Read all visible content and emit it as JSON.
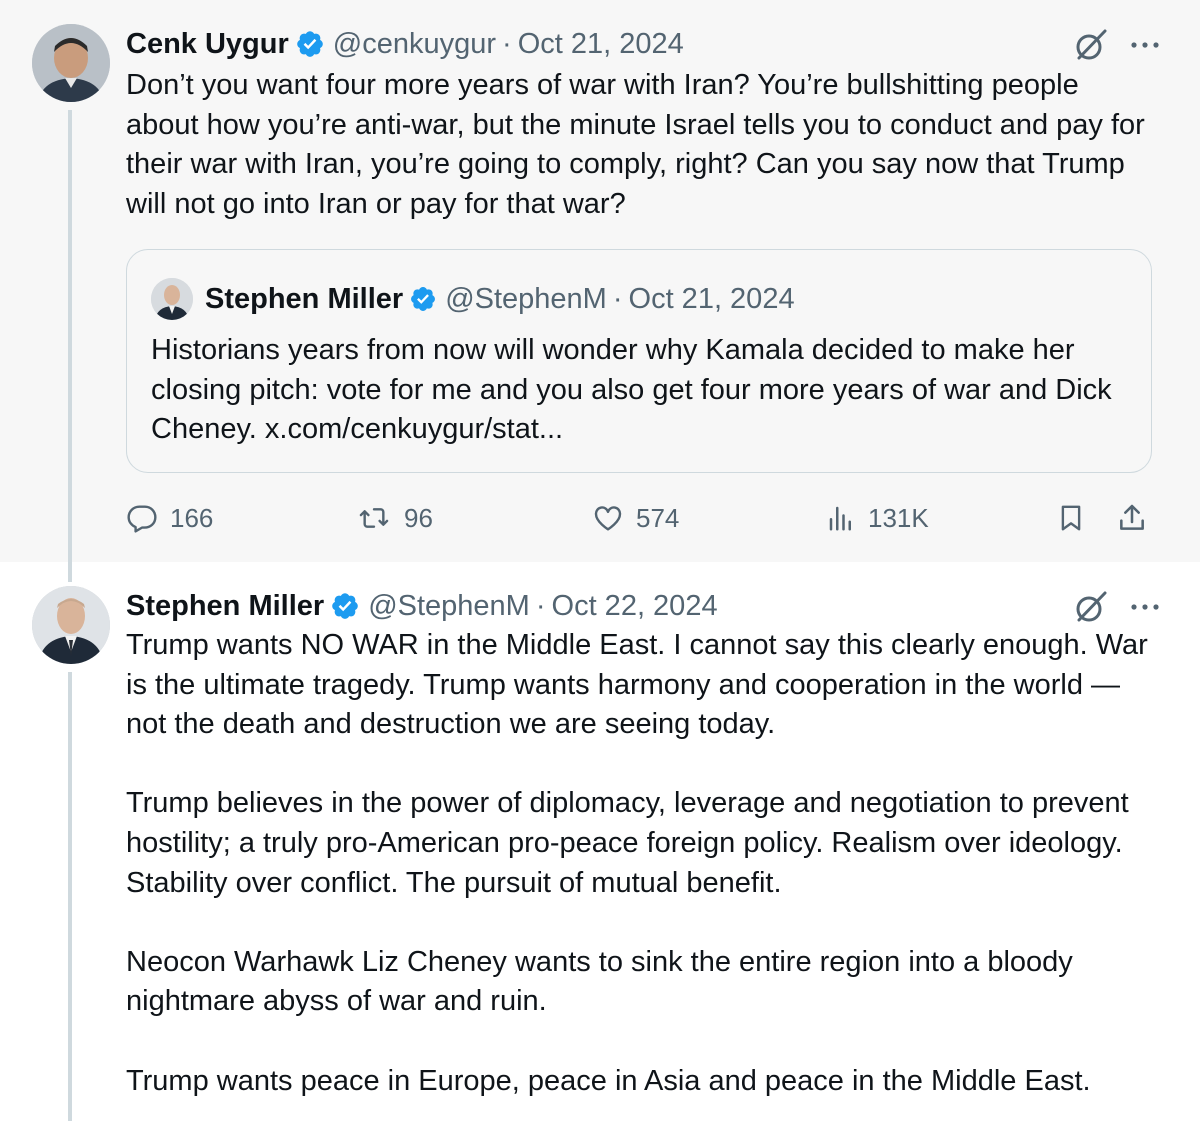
{
  "tweets": [
    {
      "author_name": "Cenk Uygur",
      "handle": "@cenkuygur",
      "separator": "·",
      "date": "Oct 21, 2024",
      "paragraphs": [
        "Don’t you want four more years of war with Iran? You’re bullshitting people about how you’re anti-war, but the minute Israel tells you to conduct and pay for their war with Iran, you’re going to comply, right? Can you say now that Trump will not go into Iran or pay for that war?"
      ],
      "quote": {
        "author_name": "Stephen Miller",
        "handle": "@StephenM",
        "separator": "·",
        "date": "Oct 21, 2024",
        "text": "Historians years from now will wonder why Kamala decided to make her closing pitch: vote for me and you also get four more years of war and Dick Cheney. x.com/cenkuygur/stat..."
      },
      "stats": {
        "replies": "166",
        "reposts": "96",
        "likes": "574",
        "views": "131K"
      }
    },
    {
      "author_name": "Stephen Miller",
      "handle": "@StephenM",
      "separator": "·",
      "date": "Oct 22, 2024",
      "paragraphs": [
        "Trump wants NO WAR in the Middle East. I cannot say this clearly enough. War is the ultimate tragedy. Trump wants harmony and cooperation in the world — not the death and destruction we are seeing today.",
        "Trump believes in the power of diplomacy, leverage and negotiation to prevent hostility; a truly pro-American pro-peace foreign policy. Realism over ideology. Stability over conflict. The pursuit of mutual benefit.",
        "Neocon Warhawk Liz Cheney wants to sink the entire region into a bloody nightmare abyss of war and ruin.",
        "Trump wants peace in Europe, peace in Asia and peace in the Middle East."
      ]
    }
  ],
  "colors": {
    "verified": "#1d9bf0",
    "text": "#0f1419",
    "muted": "#536471",
    "border": "#cfd9de",
    "highlight_bg": "#f7f7f7"
  },
  "icons": {
    "verified": "verified-badge-icon",
    "grok": "grok-icon",
    "more": "more-icon",
    "reply": "reply-icon",
    "repost": "repost-icon",
    "like": "like-icon",
    "views": "views-icon",
    "bookmark": "bookmark-icon",
    "share": "share-icon"
  }
}
